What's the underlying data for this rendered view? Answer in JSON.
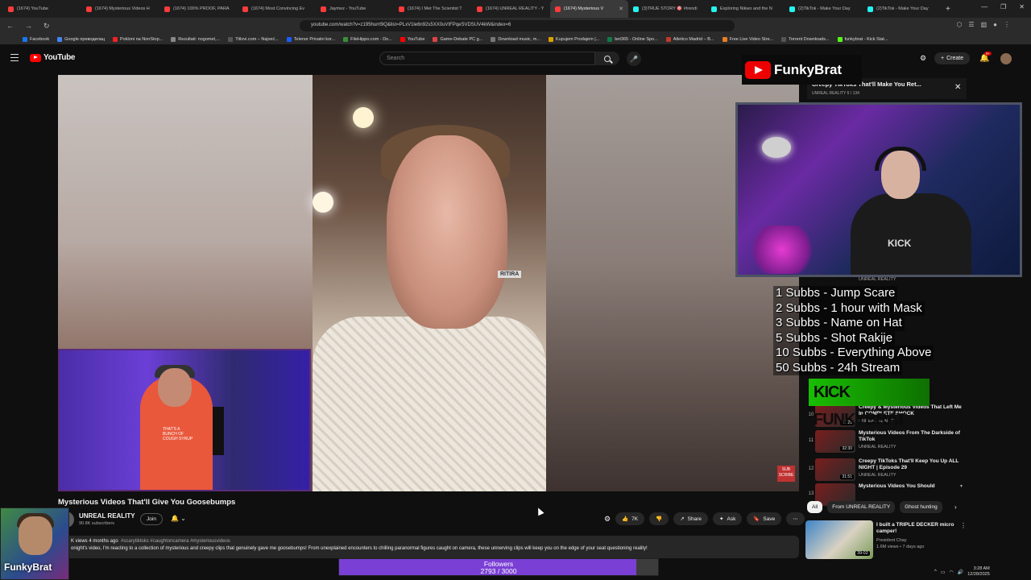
{
  "browser": {
    "tabs": [
      {
        "title": "(1674) YouTube",
        "color": "#ff3b3b"
      },
      {
        "title": "(1674) Mysterious Videos H",
        "color": "#ff3b3b"
      },
      {
        "title": "(1674) 100% PROOF, PARA",
        "color": "#ff3b3b"
      },
      {
        "title": "(1674) Most Convincing Ev",
        "color": "#ff3b3b"
      },
      {
        "title": "Jaymez - YouTube",
        "color": "#ff3b3b"
      },
      {
        "title": "(1674) I Met The Scientist T",
        "color": "#ff3b3b"
      },
      {
        "title": "(1674) UNREAL REALITY - Y",
        "color": "#ff3b3b"
      },
      {
        "title": "(1674) Mysterious V",
        "color": "#ff3b3b",
        "active": true
      },
      {
        "title": "(3)TRUE STORY 🎯 #trendi",
        "color": "#25f4ee"
      },
      {
        "title": "Exploring Nikwo and the N",
        "color": "#25f4ee"
      },
      {
        "title": "(2)TikTok - Make Your Day",
        "color": "#25f4ee"
      },
      {
        "title": "(2)TikTok - Make Your Day",
        "color": "#25f4ee"
      }
    ],
    "url": "youtube.com/watch?v=z195hurrt9Q&list=PLxV1le6n92s5XX0uVtFPqeSVDSUV4kW&index=6",
    "bookmarks": [
      {
        "label": "Facebook",
        "color": "#1877f2"
      },
      {
        "label": "Google преводилац",
        "color": "#4285f4"
      },
      {
        "label": "Pokloni na NonStop...",
        "color": "#e22"
      },
      {
        "label": "Rezultati: nogomet,...",
        "color": "#888"
      },
      {
        "label": "Titlovi.com – Najveć...",
        "color": "#555"
      },
      {
        "label": "Telenor Privatni kor...",
        "color": "#1a5cff"
      },
      {
        "label": "FileHippo.com - Do...",
        "color": "#3a8d3a"
      },
      {
        "label": "YouTube",
        "color": "#f00"
      },
      {
        "label": "Game-Debate PC g...",
        "color": "#d44"
      },
      {
        "label": "Download music, m...",
        "color": "#777"
      },
      {
        "label": "Kupujem Prodajem |...",
        "color": "#d8a200"
      },
      {
        "label": "bet365 - Online Spo...",
        "color": "#127a4a"
      },
      {
        "label": "Atletico Madrid – B...",
        "color": "#c0392b"
      },
      {
        "label": "Free Live Video Stre...",
        "color": "#e67e22"
      },
      {
        "label": "Torrent Downloads...",
        "color": "#555"
      },
      {
        "label": "funkybrat - Kick Stat...",
        "color": "#53fc18"
      }
    ]
  },
  "youtube": {
    "logo_text": "YouTube",
    "search_placeholder": "Search",
    "create_label": "Create",
    "notifications_badge": "9+"
  },
  "video": {
    "title": "Mysterious Videos That'll Give You Goosebumps",
    "channel": "UNREAL REALITY",
    "subscribers": "90.8K subscribers",
    "join_label": "Join",
    "likes": "7K",
    "share_label": "Share",
    "ask_label": "Ask",
    "save_label": "Save",
    "meta": "K views  4 months ago",
    "tags": "#scarytiktoks #caughtoncamera #mysteriousvideos",
    "description": "onight's video, I'm reacting to a collection of mysterious and creepy clips that genuinely gave me goosebumps! From unexplained encounters to chilling paranormal figures caught on camera, these unnerving clips will keep you on the edge of your seat questioning reality!",
    "sign_text": "RITIRA",
    "subscribe_watermark": "SUB SCRIBE",
    "cam_shirt_text": "THAT'S A BUNCH OF COUGH SYRUP"
  },
  "overlay": {
    "streamer_name": "FunkyBrat",
    "logo_name": "FunkyBrat",
    "kick_banner": "KICK FUNKYBRAT",
    "cam_shirt": "KICK",
    "followers_label": "Followers",
    "followers_count": "2793 / 3000",
    "followers_progress": 0.931,
    "sub_goals": [
      "1 Subbs - Jump Scare",
      "2 Subbs - 1 hour with Mask",
      "3 Subbs - Name on Hat",
      "5 Subbs - Shot Rakije",
      "10 Subbs - Everything Above",
      "50 Subbs - 24h Stream"
    ]
  },
  "playlist": {
    "title": "Creepy TikToks That'll Make You Ret...",
    "subtitle": "UNREAL REALITY  6 / 134",
    "items": [
      {
        "num": "",
        "title": "",
        "channel": "UNREAL REALITY",
        "duration": ""
      },
      {
        "num": "10",
        "title": "Creepy & Mysterious Videos That Left Me In COMPLETE SHOCK",
        "channel": "UNREAL REALITY",
        "duration": "31:29"
      },
      {
        "num": "11",
        "title": "Mysterious Videos From The Darkside of TikTok",
        "channel": "UNREAL REALITY",
        "duration": "32:30"
      },
      {
        "num": "12",
        "title": "Creepy TikToks That'll Keep You Up ALL NIGHT | Episode 29",
        "channel": "UNREAL REALITY",
        "duration": "31:51"
      },
      {
        "num": "13",
        "title": "Mysterious Videos You Should",
        "channel": "",
        "duration": ""
      }
    ]
  },
  "chips": [
    "All",
    "From UNREAL REALITY",
    "Ghost hunting"
  ],
  "recommendation": {
    "title": "I built a TRIPLE DECKER micro camper!",
    "channel": "President Chay",
    "meta": "1.6M views • 7 days ago",
    "duration": "39:02"
  },
  "taskbar": {
    "time": "3:28 AM",
    "date": "12/28/2025"
  }
}
